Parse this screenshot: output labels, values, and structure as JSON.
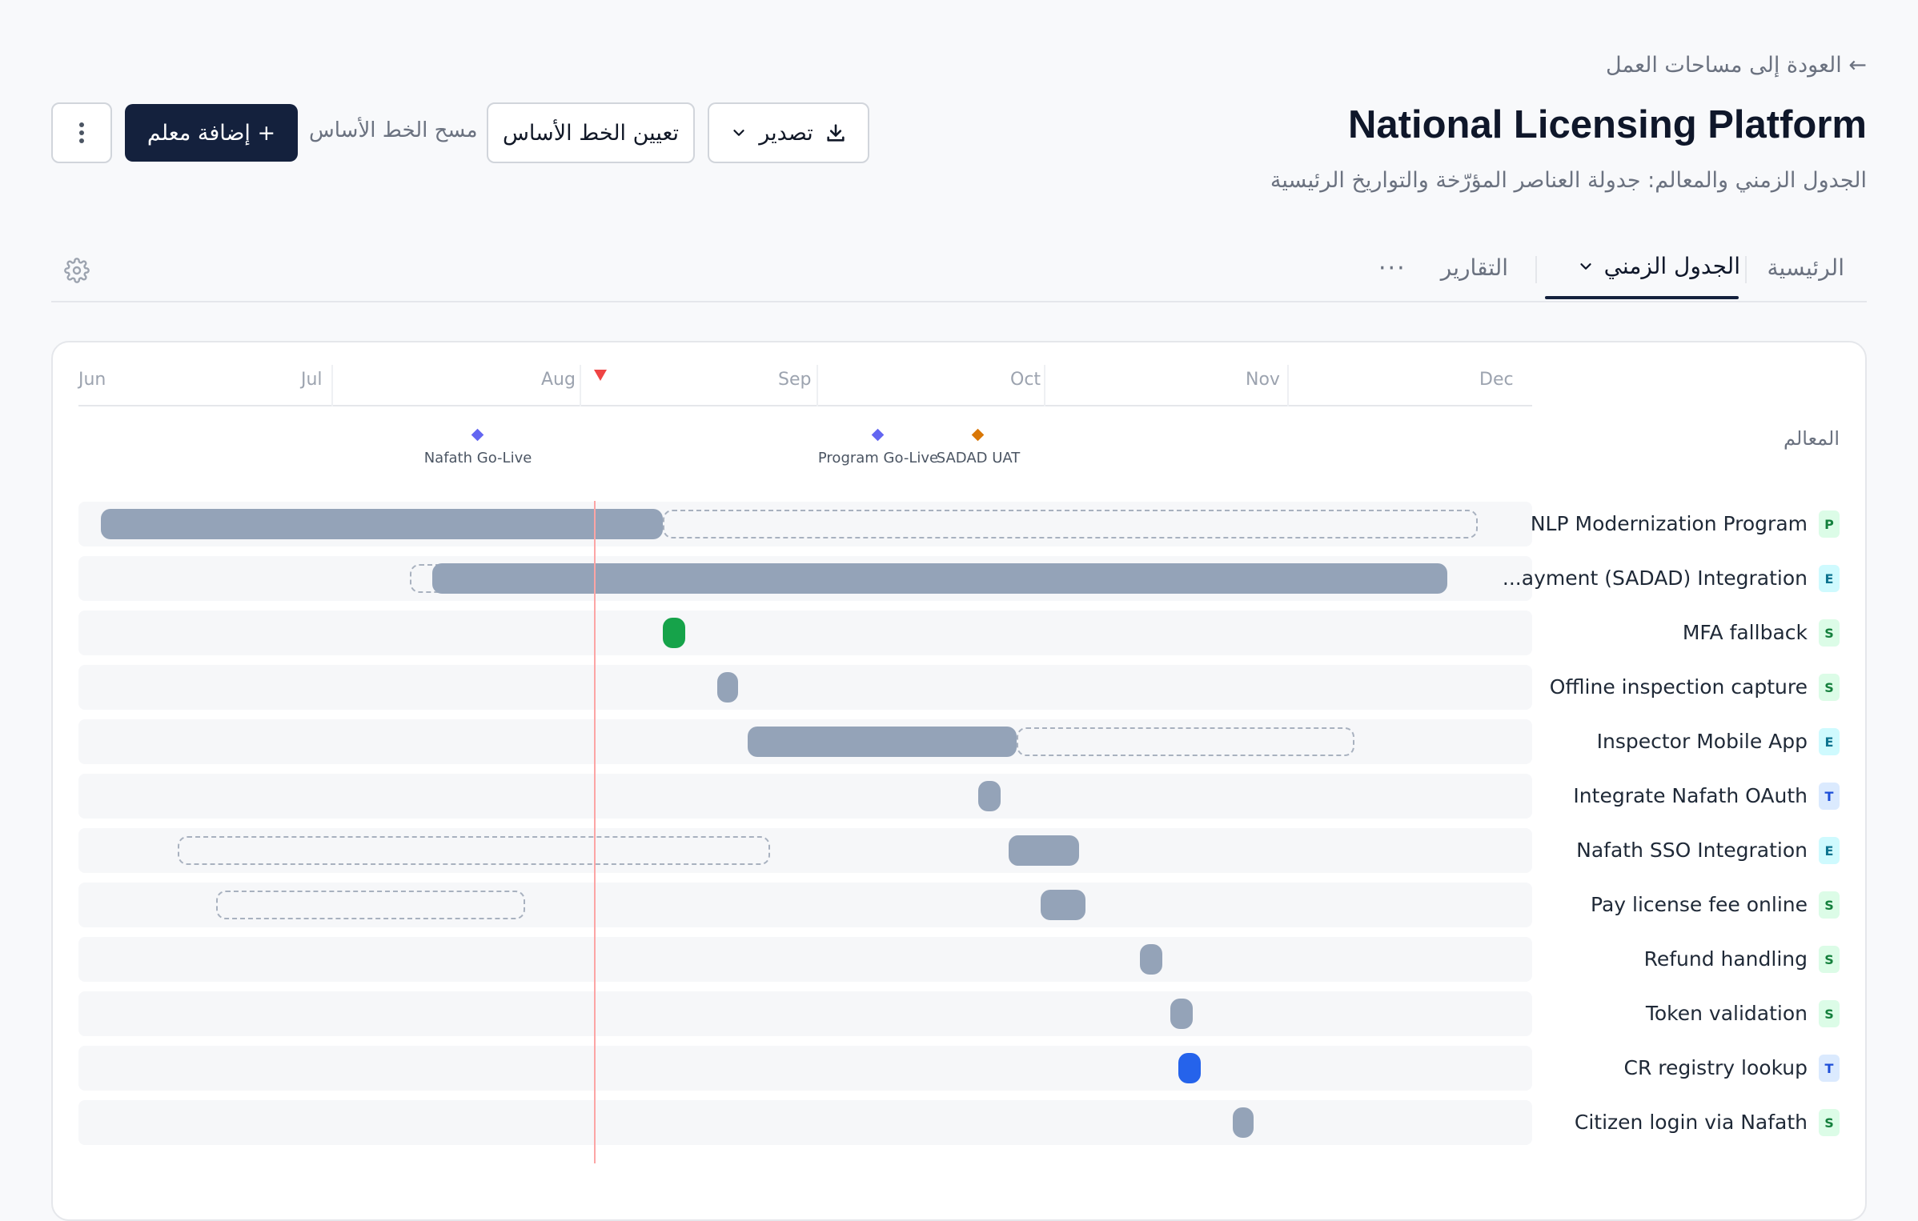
{
  "header": {
    "back_link": "← العودة إلى مساحات العمل",
    "title": "National Licensing Platform",
    "subtitle": "الجدول الزمني والمعالم: جدولة العناصر المؤرّخة والتواريخ الرئيسية"
  },
  "toolbar": {
    "export_label": "تصدير",
    "set_baseline_label": "تعيين الخط الأساس",
    "clear_baseline_label": "مسح الخط الأساس",
    "add_milestone_label": "+ إضافة معلم",
    "export_icon": "download-icon",
    "more_icon": "kebab-vertical-icon"
  },
  "tabs": {
    "home": "الرئيسية",
    "timeline": "الجدول الزمني",
    "reports": "التقارير",
    "more": "···",
    "settings_icon": "gear-icon"
  },
  "timeline": {
    "months": [
      "Jun",
      "Jul",
      "Aug",
      "Sep",
      "Oct",
      "Nov",
      "Dec"
    ],
    "milestones_label": "المعالم",
    "today_marker": "today",
    "milestones": [
      {
        "name": "Nafath Go-Live",
        "color": "#6366f1"
      },
      {
        "name": "Program Go-Live",
        "color": "#6366f1"
      },
      {
        "name": "SADAD UAT",
        "color": "#d97706"
      }
    ],
    "rows": [
      {
        "name": "NLP Modernization Program",
        "badge": "P",
        "bar_color": "#94a3b8"
      },
      {
        "name": "...ayment (SADAD) Integration",
        "badge": "E",
        "bar_color": "#94a3b8"
      },
      {
        "name": "MFA fallback",
        "badge": "S",
        "bar_color": "#16a34a"
      },
      {
        "name": "Offline inspection capture",
        "badge": "S",
        "bar_color": "#94a3b8"
      },
      {
        "name": "Inspector Mobile App",
        "badge": "E",
        "bar_color": "#94a3b8"
      },
      {
        "name": "Integrate Nafath OAuth",
        "badge": "T",
        "bar_color": "#94a3b8"
      },
      {
        "name": "Nafath SSO Integration",
        "badge": "E",
        "bar_color": "#94a3b8"
      },
      {
        "name": "Pay license fee online",
        "badge": "S",
        "bar_color": "#94a3b8"
      },
      {
        "name": "Refund handling",
        "badge": "S",
        "bar_color": "#94a3b8"
      },
      {
        "name": "Token validation",
        "badge": "S",
        "bar_color": "#94a3b8"
      },
      {
        "name": "CR registry lookup",
        "badge": "T",
        "bar_color": "#2563eb"
      },
      {
        "name": "Citizen login via Nafath",
        "badge": "S",
        "bar_color": "#94a3b8"
      }
    ]
  }
}
